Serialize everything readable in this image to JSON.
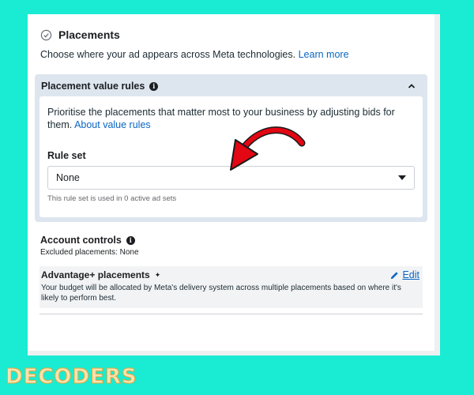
{
  "placements": {
    "title": "Placements",
    "subtitle": "Choose where your ad appears across Meta technologies.",
    "learn_more": "Learn more"
  },
  "value_rules": {
    "title": "Placement value rules",
    "description": "Prioritise the placements that matter most to your business by adjusting bids for them.",
    "about_link": "About value rules",
    "rule_set_label": "Rule set",
    "rule_set_value": "None",
    "helper": "This rule set is used in 0 active ad sets"
  },
  "account_controls": {
    "title": "Account controls",
    "excluded": "Excluded placements: None"
  },
  "advantage": {
    "title": "Advantage+ placements",
    "edit_label": "Edit",
    "description": "Your budget will be allocated by Meta's delivery system across multiple placements based on where it's likely to perform best."
  },
  "watermark": "DECODERS",
  "colors": {
    "background": "#19ecd3",
    "link": "#0a66c2",
    "section_bg": "#dde6ef",
    "arrow": "#e30613"
  },
  "icons": [
    "check-circle-icon",
    "info-icon",
    "chevron-up-icon",
    "caret-down-icon",
    "sparkle-icon",
    "pencil-icon",
    "red-arrow"
  ]
}
